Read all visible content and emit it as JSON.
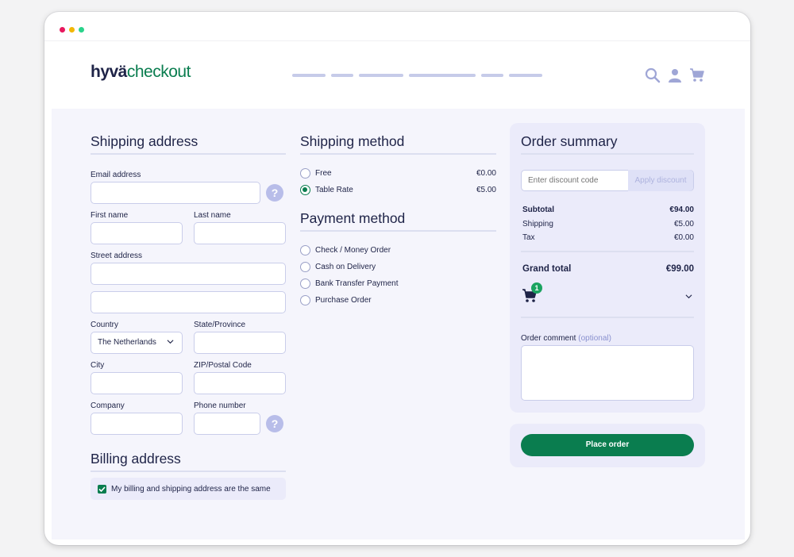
{
  "header": {
    "logo_part1": "hyvä",
    "logo_part2": "checkout"
  },
  "colors": {
    "brand_green": "#0a7d4f",
    "dot_red": "#e8185e",
    "dot_yellow": "#f2b705",
    "dot_green": "#2ad38b",
    "accent_lavender": "#b8bde9"
  },
  "icons": [
    "search-icon",
    "user-icon",
    "cart-icon"
  ],
  "shipping_address": {
    "title": "Shipping address",
    "email_label": "Email address",
    "first_name_label": "First name",
    "last_name_label": "Last name",
    "street_label": "Street address",
    "country_label": "Country",
    "country_value": "The Netherlands",
    "state_label": "State/Province",
    "city_label": "City",
    "zip_label": "ZIP/Postal Code",
    "company_label": "Company",
    "phone_label": "Phone number",
    "help_glyph": "?"
  },
  "billing_address": {
    "title": "Billing address",
    "same_label": "My billing and shipping address are the same",
    "same_checked": true
  },
  "shipping_method": {
    "title": "Shipping method",
    "options": [
      {
        "label": "Free",
        "price": "€0.00",
        "selected": false
      },
      {
        "label": "Table Rate",
        "price": "€5.00",
        "selected": true
      }
    ]
  },
  "payment_method": {
    "title": "Payment method",
    "options": [
      {
        "label": "Check / Money Order"
      },
      {
        "label": "Cash on Delivery"
      },
      {
        "label": "Bank Transfer Payment"
      },
      {
        "label": "Purchase Order"
      }
    ]
  },
  "order_summary": {
    "title": "Order summary",
    "discount_placeholder": "Enter discount code",
    "apply_label": "Apply discount",
    "subtotal_label": "Subtotal",
    "subtotal_value": "€94.00",
    "shipping_label": "Shipping",
    "shipping_value": "€5.00",
    "tax_label": "Tax",
    "tax_value": "€0.00",
    "grand_total_label": "Grand total",
    "grand_total_value": "€99.00",
    "cart_count": "1",
    "comment_label": "Order comment",
    "comment_optional": "(optional)"
  },
  "place_order_label": "Place order"
}
